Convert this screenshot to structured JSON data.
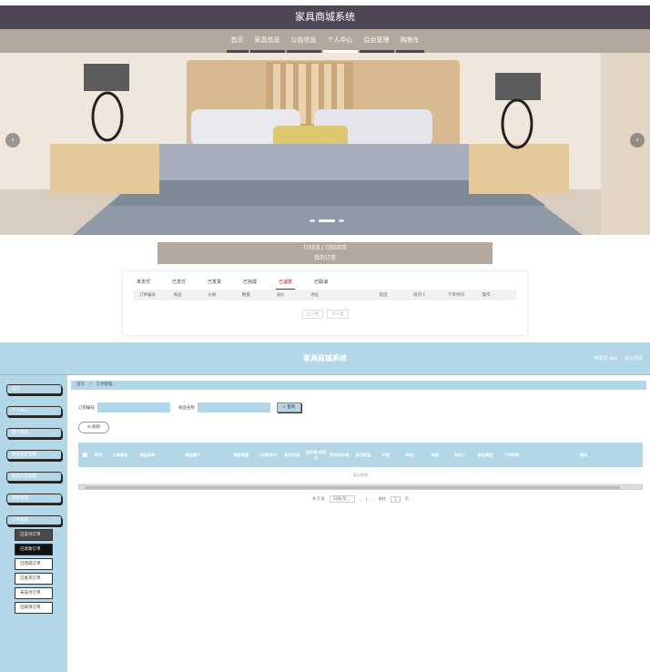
{
  "front": {
    "site_title": "家具商城系统",
    "nav": [
      "首页",
      "家具信息",
      "公告信息",
      "个人中心",
      "后台管理",
      "购物车"
    ],
    "nav_active": "个人中心",
    "order_head_en": "USER / ORDER",
    "order_head_cn": "我的订单",
    "order_tabs": [
      "未支付",
      "已支付",
      "已发货",
      "已完成",
      "已退款",
      "已取消"
    ],
    "order_tab_active": "已退款",
    "order_columns": [
      "订单编号",
      "商品",
      "价格",
      "数量",
      "总价",
      "地址",
      "电话",
      "收货人",
      "下单时间",
      "操作"
    ],
    "pager": [
      "上一页",
      "下一页"
    ]
  },
  "admin": {
    "title": "家具商城系统",
    "user_role": "管理员 abo",
    "logout": "退出登录",
    "sidebar": [
      "首页",
      "个人中心",
      "用户管理",
      "家具类型管理",
      "家具信息管理",
      "系统管理",
      "订单管理"
    ],
    "order_sub": [
      "已支付订单",
      "已退款订单",
      "已完成订单",
      "已发货订单",
      "未支付订单",
      "已取消订单"
    ],
    "order_sub_selected": "已退款订单",
    "breadcrumb": [
      "首页",
      "订单管理"
    ],
    "search": {
      "order_no_label": "订单编号",
      "goods_name_label": "商品名称",
      "query_btn": "查询"
    },
    "delete_btn": "删除",
    "table_columns": [
      "索引",
      "订单编号",
      "商品名称",
      "商品图片",
      "购买数量",
      "价格/积分",
      "折扣价格",
      "总价格/总积分",
      "折扣总价格",
      "支付类型",
      "状态",
      "地址",
      "电话",
      "收货人",
      "商品类型",
      "下单时间",
      "操作"
    ],
    "empty_text": "暂无数据",
    "pagination": {
      "total": "共 0 条",
      "page_size": "10条/页",
      "current": "1",
      "goto": "前往",
      "goto_value": "1",
      "page": "页"
    }
  }
}
